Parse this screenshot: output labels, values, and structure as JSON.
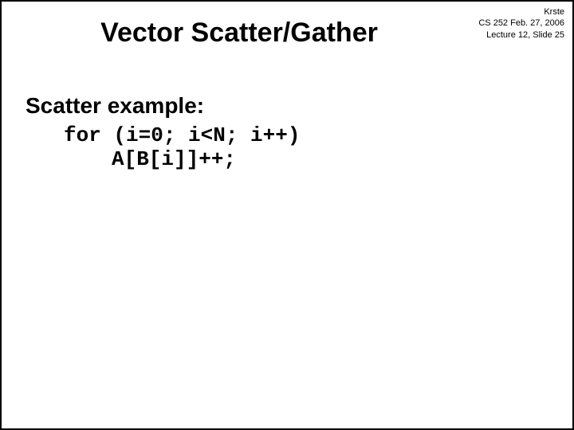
{
  "meta": {
    "author": "Krste",
    "course_date": "CS 252 Feb. 27, 2006",
    "lecture_slide": "Lecture 12, Slide 25"
  },
  "title": "Vector Scatter/Gather",
  "content": {
    "subtitle": "Scatter example:",
    "code_line1": "for (i=0; i<N; i++)",
    "code_line2": "A[B[i]]++;"
  }
}
